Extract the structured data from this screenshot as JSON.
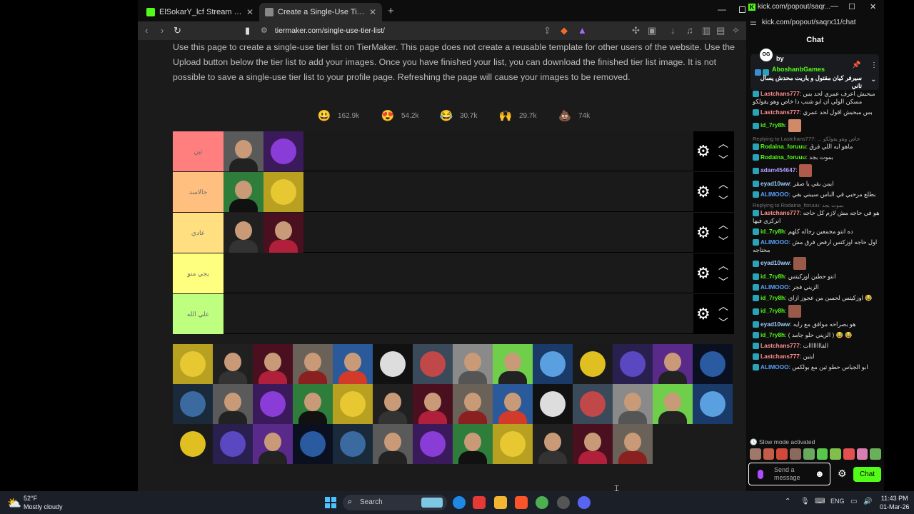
{
  "browser": {
    "tabs": [
      {
        "title": "ElSokarY_lcf Stream - Watch Live on K",
        "favicon_color": "#53fc18"
      },
      {
        "title": "Create a Single-Use Tier List (Pri",
        "favicon_color": "#444444"
      }
    ],
    "new_tab": "+",
    "url": "tiermaker.com/single-use-tier-list/"
  },
  "page": {
    "intro": "Use this page to create a single-use tier list on TierMaker. This page does not create a reusable template for other users of the website. Use the Upload button below the tier list to add your images. Once you have finished your list, you can download the finished tier list image. It is not possible to save a single-use tier list to your profile page. Refreshing the page will cause your images to be removed.",
    "reactions": [
      {
        "icon": "😃",
        "count": "162.9k"
      },
      {
        "icon": "😍",
        "count": "54.2k"
      },
      {
        "icon": "😂",
        "count": "30.7k"
      },
      {
        "icon": "🙌",
        "count": "29.7k"
      },
      {
        "icon": "💩",
        "count": "74k"
      }
    ],
    "tiers": [
      {
        "label": "ثين",
        "color": "#ff7f7f",
        "items": 2
      },
      {
        "label": "جالاسد",
        "color": "#ffbf7f",
        "items": 2
      },
      {
        "label": "عادي",
        "color": "#ffdf7f",
        "items": 2
      },
      {
        "label": "يجي منو",
        "color": "#ffff7f",
        "items": 0
      },
      {
        "label": "علي الله",
        "color": "#bfff7f",
        "items": 0
      }
    ],
    "pool_count": 40
  },
  "chat": {
    "window_url": "kick.com/popout/saqr...",
    "address": "kick.com/popout/saqrx11/chat",
    "header": "Chat",
    "pinned": {
      "badge": "OG",
      "by_label": "by",
      "user": "AboshanbGames",
      "message": "سيرفر كيان مقتول و ياريت محدش يسال تاني"
    },
    "messages": [
      {
        "user": "Lastchans777",
        "color": "#ff8f8f",
        "text": "مبحبش اعرف عمري لحد بس مسكن الولي ان ابو شنب دا خاص وهو يقولكو",
        "reply": "",
        "emote": false
      },
      {
        "user": "Lastchans777",
        "color": "#ff8f8f",
        "text": "بس مبحبش اقول لحد عمري",
        "reply": "",
        "emote": false
      },
      {
        "user": "id_7ry8h",
        "color": "#53fc18",
        "text": "",
        "reply": "",
        "emote": true
      },
      {
        "user": "Rodaina_foruuu",
        "color": "#53fc18",
        "text": "ماهو ايه اللي فرق",
        "reply": "Replying to Lastchans777: ... خاص وهو يقولكو",
        "emote": false
      },
      {
        "user": "Rodaina_foruuu",
        "color": "#53fc18",
        "text": "بموت بجد",
        "reply": "",
        "emote": false
      },
      {
        "user": "adam454647",
        "color": "#b39dff",
        "text": "",
        "reply": "",
        "emote": true
      },
      {
        "user": "eyad10ww",
        "color": "#9ecbff",
        "text": "ايمن بقي يا صقر",
        "reply": "",
        "emote": false
      },
      {
        "user": "ALIMOOO",
        "color": "#5aa0ff",
        "text": "بطلع مرحبي في الناس سيبني بقي",
        "reply": "",
        "emote": false
      },
      {
        "user": "Lastchans777",
        "color": "#ff8f8f",
        "text": "هو في حاجه مش لازم كل حاجه انركزي فيها",
        "reply": "Replying to Rodaina_foruuu: بموت بجد",
        "emote": false
      },
      {
        "user": "id_7ry8h",
        "color": "#53fc18",
        "text": "ده انتو مجمعين رجاله كلهم",
        "reply": "",
        "emote": false
      },
      {
        "user": "ALIMOOO",
        "color": "#5aa0ff",
        "text": "اول حاجه اوزكتس ارفض فرق مش محتاجه",
        "reply": "",
        "emote": false
      },
      {
        "user": "eyad10ww",
        "color": "#9ecbff",
        "text": "",
        "reply": "",
        "emote": true
      },
      {
        "user": "id_7ry8h",
        "color": "#53fc18",
        "text": "انتو حطين اوزكيتس",
        "reply": "",
        "emote": false
      },
      {
        "user": "ALIMOOO",
        "color": "#5aa0ff",
        "text": "الزيني فجر",
        "reply": "",
        "emote": false
      },
      {
        "user": "id_7ry8h",
        "color": "#53fc18",
        "text": "اوزكيتس لحسن من عجوز ازاي 😂",
        "reply": "",
        "emote": false
      },
      {
        "user": "id_7ry8h",
        "color": "#53fc18",
        "text": "",
        "reply": "",
        "emote": true
      },
      {
        "user": "eyad10ww",
        "color": "#9ecbff",
        "text": "هو بصراحه موافق مع رايه",
        "reply": "",
        "emote": false
      },
      {
        "user": "id_7ry8h",
        "color": "#53fc18",
        "text": "( الزيني حلو جامد ) 😂 😂",
        "reply": "",
        "emote": false
      },
      {
        "user": "Lastchans777",
        "color": "#ff8f8f",
        "text": "الفاااااااات",
        "reply": "",
        "emote": false
      },
      {
        "user": "Lastchans777",
        "color": "#ff8f8f",
        "text": "ايتين",
        "reply": "",
        "emote": false
      },
      {
        "user": "ALIMOOO",
        "color": "#5aa0ff",
        "text": "ابو الجباس حطو ثين مع بولكس",
        "reply": "",
        "emote": false
      }
    ],
    "slow_mode": "Slow mode activated",
    "input_placeholder": "Send a message",
    "send_label": "Chat"
  },
  "taskbar": {
    "temp": "52°F",
    "condition": "Mostly cloudy",
    "search": "Search",
    "lang": "ENG",
    "time": "11:43 PM",
    "date": "01-Mar-26"
  }
}
